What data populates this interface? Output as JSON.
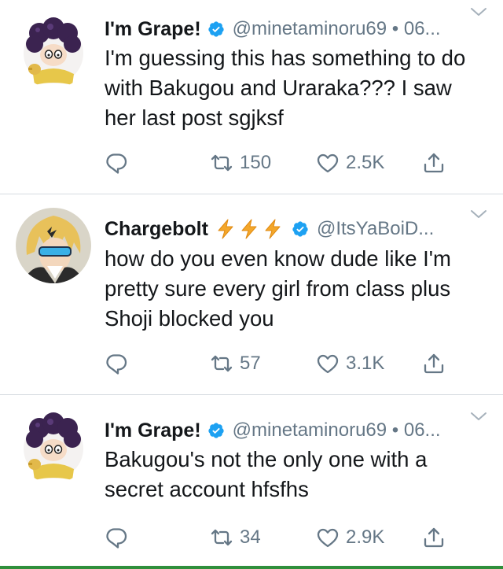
{
  "tweets": [
    {
      "display_name": "I'm Grape!",
      "handle_time": "@minetaminoru69 • 06...",
      "text": "I'm guessing this has something to do with Bakugou and Uraraka??? I saw her last post sgjksf",
      "retweets": "150",
      "likes": "2.5K"
    },
    {
      "display_name": "Chargebolt",
      "handle_time": "@ItsYaBoiD...",
      "text": "how do you even know dude like I'm pretty sure every girl from class plus Shoji blocked you",
      "retweets": "57",
      "likes": "3.1K"
    },
    {
      "display_name": "I'm Grape!",
      "handle_time": "@minetaminoru69 • 06...",
      "text": "Bakugou's not the only one with a secret account hfsfhs",
      "retweets": "34",
      "likes": "2.9K"
    }
  ],
  "icons": {
    "verified": "verified-badge-icon",
    "reply": "reply-icon",
    "retweet": "retweet-icon",
    "like": "heart-icon",
    "share": "share-icon",
    "more": "chevron-down-icon",
    "bolt": "lightning-bolt-emoji"
  },
  "colors": {
    "verified": "#1da1f2",
    "muted": "#657786",
    "bolt": "#f4a72a",
    "text": "#14171a"
  }
}
